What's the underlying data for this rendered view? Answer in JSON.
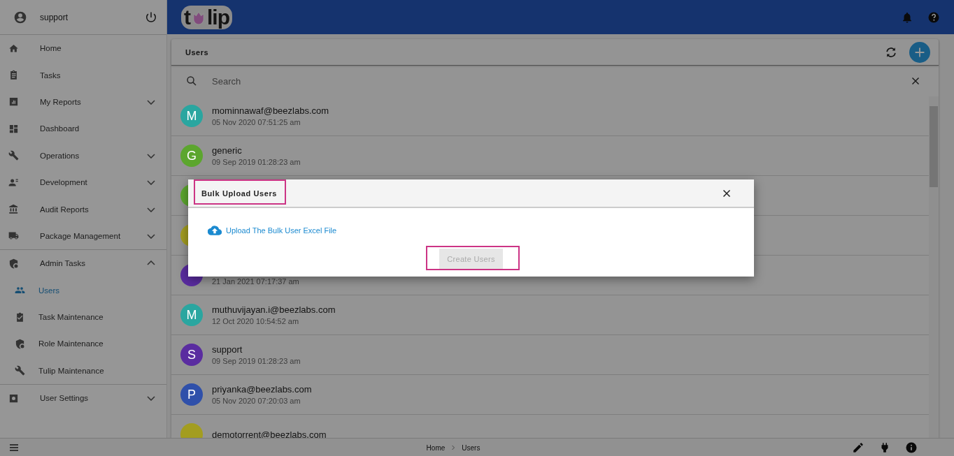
{
  "user": {
    "name": "support"
  },
  "sidebar": {
    "items": [
      {
        "label": "Home",
        "kind": "link",
        "selected": false
      },
      {
        "label": "Tasks",
        "kind": "link",
        "selected": false
      },
      {
        "label": "My Reports",
        "kind": "group",
        "expanded": false,
        "selected": false
      },
      {
        "label": "Dashboard",
        "kind": "link",
        "selected": false
      },
      {
        "label": "Operations",
        "kind": "group",
        "expanded": false,
        "selected": false
      },
      {
        "label": "Development",
        "kind": "group",
        "expanded": false,
        "selected": false
      },
      {
        "label": "Audit Reports",
        "kind": "group",
        "expanded": false,
        "selected": false
      },
      {
        "label": "Package Management",
        "kind": "group",
        "expanded": false,
        "selected": false
      },
      {
        "label": "Admin Tasks",
        "kind": "group",
        "expanded": true,
        "selected": false,
        "children": [
          {
            "label": "Users",
            "selected": true
          },
          {
            "label": "Task Maintenance",
            "selected": false
          },
          {
            "label": "Role Maintenance",
            "selected": false
          },
          {
            "label": "Tulip Maintenance",
            "selected": false
          }
        ]
      },
      {
        "label": "User Settings",
        "kind": "group",
        "expanded": false,
        "selected": false
      }
    ]
  },
  "header": {
    "logo_start": "t",
    "logo_end": "lip"
  },
  "panel": {
    "title": "Users",
    "search": {
      "placeholder": "Search"
    }
  },
  "users": [
    {
      "initial": "M",
      "color": "#2aa6a0",
      "name": "mominnawaf@beezlabs.com",
      "date": "05 Nov 2020 07:51:25 am"
    },
    {
      "initial": "G",
      "color": "#5ca62e",
      "name": "generic",
      "date": "09 Sep 2019 01:28:23 am"
    },
    {
      "color": "#5ca62e"
    },
    {
      "color": "#a39d20"
    },
    {
      "color": "#5a2ca0",
      "date": "21 Jan 2021 07:17:37 am"
    },
    {
      "initial": "M",
      "color": "#2aa6a0",
      "name": "muthuvijayan.i@beezlabs.com",
      "date": "12 Oct 2020 10:54:52 am"
    },
    {
      "initial": "S",
      "color": "#5a2ca0",
      "name": "support",
      "date": "09 Sep 2019 01:28:23 am"
    },
    {
      "initial": "P",
      "color": "#2f50aa",
      "name": "priyanka@beezlabs.com",
      "date": "05 Nov 2020 07:20:03 am"
    },
    {
      "color": "#a39d20",
      "name": "demotorrent@beezlabs.com"
    }
  ],
  "breadcrumb": [
    {
      "label": "Home"
    },
    {
      "label": "Users"
    }
  ],
  "dialog": {
    "title": "Bulk Upload Users",
    "upload_link": "Upload The Bulk User Excel File",
    "button": {
      "label": "Create Users",
      "disabled": true
    }
  }
}
